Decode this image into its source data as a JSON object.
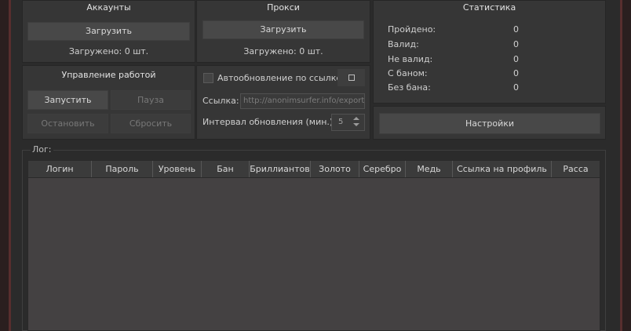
{
  "accounts": {
    "title": "Аккаунты",
    "load_button": "Загрузить",
    "loaded_text": "Загружено: 0 шт."
  },
  "proxy": {
    "title": "Прокси",
    "load_button": "Загрузить",
    "loaded_text": "Загружено: 0 шт.",
    "auto_update_label": "Автообновление по ссылке",
    "auto_update_checked": false,
    "small_button_icon": "square-icon",
    "link_label": "Ссылка:",
    "link_value": "http://anonimsurfer.info/export/t",
    "interval_label": "Интервал обновления (мин.):",
    "interval_value": "5"
  },
  "statistics": {
    "title": "Статистика",
    "rows": [
      {
        "label": "Пройдено:",
        "value": "0"
      },
      {
        "label": "Валид:",
        "value": "0"
      },
      {
        "label": "Не валид:",
        "value": "0"
      },
      {
        "label": "С баном:",
        "value": "0"
      },
      {
        "label": "Без бана:",
        "value": "0"
      }
    ]
  },
  "work_control": {
    "title": "Управление работой",
    "start": "Запустить",
    "pause": "Пауза",
    "stop": "Остановить",
    "reset": "Сбросить"
  },
  "settings_button": "Настройки",
  "log": {
    "label": "Лог:",
    "columns": [
      "Логин",
      "Пароль",
      "Уровень",
      "Бан",
      "Бриллиантов",
      "Золото",
      "Серебро",
      "Медь",
      "Ссылка на профиль",
      "Расса"
    ]
  },
  "colors": {
    "panel": "#363636",
    "button": "#484848",
    "text": "#cfcfcf",
    "border_glow": "#7d3a3a"
  }
}
